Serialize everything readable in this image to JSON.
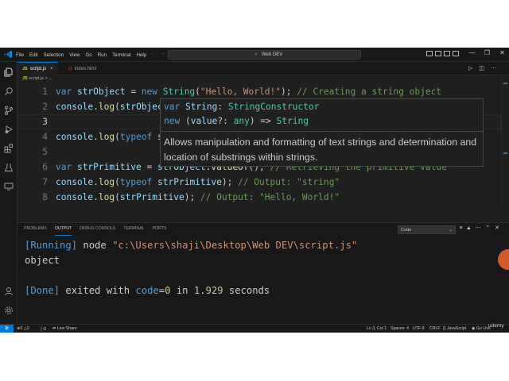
{
  "menu": [
    "File",
    "Edit",
    "Selection",
    "View",
    "Go",
    "Run",
    "Terminal",
    "Help"
  ],
  "title_bar": {
    "search_text": "Web DEV",
    "window_controls": [
      "—",
      "❐",
      "✕"
    ]
  },
  "tabs": [
    {
      "label": "script.js",
      "icon": "js-file-icon",
      "active": true,
      "close": "×"
    },
    {
      "label": "index.html",
      "icon": "html-file-icon",
      "active": false
    }
  ],
  "breadcrumb": {
    "file": "script.js",
    "rest": "> ..."
  },
  "editor": {
    "lines": [
      {
        "num": "1",
        "tokens": [
          [
            "kw",
            "var "
          ],
          [
            "var",
            "strObject"
          ],
          [
            "pl",
            " = "
          ],
          [
            "kw",
            "new "
          ],
          [
            "cls",
            "String"
          ],
          [
            "pl",
            "("
          ],
          [
            "str",
            "\"Hello, World!\""
          ],
          [
            "pl",
            "); "
          ],
          [
            "cm",
            "// Creating a string object"
          ]
        ]
      },
      {
        "num": "2",
        "tokens": [
          [
            "var",
            "console"
          ],
          [
            "pl",
            "."
          ],
          [
            "fn",
            "log"
          ],
          [
            "pl",
            "("
          ],
          [
            "var",
            "strObjec"
          ]
        ]
      },
      {
        "num": "3",
        "tokens": []
      },
      {
        "num": "4",
        "tokens": [
          [
            "var",
            "console"
          ],
          [
            "pl",
            "."
          ],
          [
            "fn",
            "log"
          ],
          [
            "pl",
            "("
          ],
          [
            "kw",
            "typeof "
          ],
          [
            "var",
            "s"
          ]
        ]
      },
      {
        "num": "5",
        "tokens": []
      },
      {
        "num": "6",
        "tokens": [
          [
            "kw",
            "var "
          ],
          [
            "var",
            "strPrimitive"
          ],
          [
            "pl",
            " = "
          ],
          [
            "var",
            "strObject"
          ],
          [
            "pl",
            "."
          ],
          [
            "fn",
            "valueOf"
          ],
          [
            "pl",
            "(); "
          ],
          [
            "cm",
            "// Retrieving the primitive value"
          ]
        ]
      },
      {
        "num": "7",
        "tokens": [
          [
            "var",
            "console"
          ],
          [
            "pl",
            "."
          ],
          [
            "fn",
            "log"
          ],
          [
            "pl",
            "("
          ],
          [
            "kw",
            "typeof "
          ],
          [
            "var",
            "strPrimitive"
          ],
          [
            "pl",
            "); "
          ],
          [
            "cm",
            "// Output: \"string\""
          ]
        ]
      },
      {
        "num": "8",
        "tokens": [
          [
            "var",
            "console"
          ],
          [
            "pl",
            "."
          ],
          [
            "fn",
            "log"
          ],
          [
            "pl",
            "("
          ],
          [
            "var",
            "strPrimitive"
          ],
          [
            "pl",
            "); "
          ],
          [
            "cm",
            "// Output: \"Hello, World!\""
          ]
        ]
      }
    ],
    "current_line": "3"
  },
  "hover": {
    "sig1": [
      [
        "kw",
        "var "
      ],
      [
        "var",
        "String"
      ],
      [
        "pl",
        ": "
      ],
      [
        "cls",
        "StringConstructor"
      ]
    ],
    "sig2": [
      [
        "kw",
        "new "
      ],
      [
        "pl",
        "("
      ],
      [
        "var",
        "value"
      ],
      [
        "pl",
        "?: "
      ],
      [
        "cls",
        "any"
      ],
      [
        "pl",
        ") => "
      ],
      [
        "cls",
        "String"
      ]
    ],
    "doc": "Allows manipulation and formatting of text strings and determination and location of substrings within strings."
  },
  "panel": {
    "tabs": [
      "PROBLEMS",
      "OUTPUT",
      "DEBUG CONSOLE",
      "TERMINAL",
      "PORTS"
    ],
    "active_tab": "OUTPUT",
    "channel": "Code",
    "output": [
      {
        "tokens": [
          [
            "tag",
            "[Running]"
          ],
          [
            "pl",
            " node "
          ],
          [
            "p",
            "\"c:\\Users\\shaji\\Desktop\\Web DEV\\script.js\""
          ]
        ]
      },
      {
        "tokens": [
          [
            "pl",
            "object"
          ]
        ]
      },
      {
        "tokens": []
      },
      {
        "tokens": [
          [
            "tag",
            "[Done]"
          ],
          [
            "pl",
            " exited with "
          ],
          [
            "tag",
            "code"
          ],
          [
            "pl",
            "="
          ],
          [
            "num",
            "0"
          ],
          [
            "pl",
            " in "
          ],
          [
            "num",
            "1.929"
          ],
          [
            "pl",
            " seconds"
          ]
        ]
      }
    ]
  },
  "status": {
    "errors": "0",
    "warnings": "0",
    "info": "0",
    "live_share": "Live Share",
    "position": "Ln 3, Col 1",
    "spaces": "Spaces: 4",
    "encoding": "UTF-8",
    "eol": "CRLF",
    "language": "JavaScript",
    "go_live": "Go Live"
  },
  "watermark": "udemy",
  "colors": {
    "accent": "#0078d4",
    "background": "#1f1f1f",
    "chrome": "#181818"
  }
}
